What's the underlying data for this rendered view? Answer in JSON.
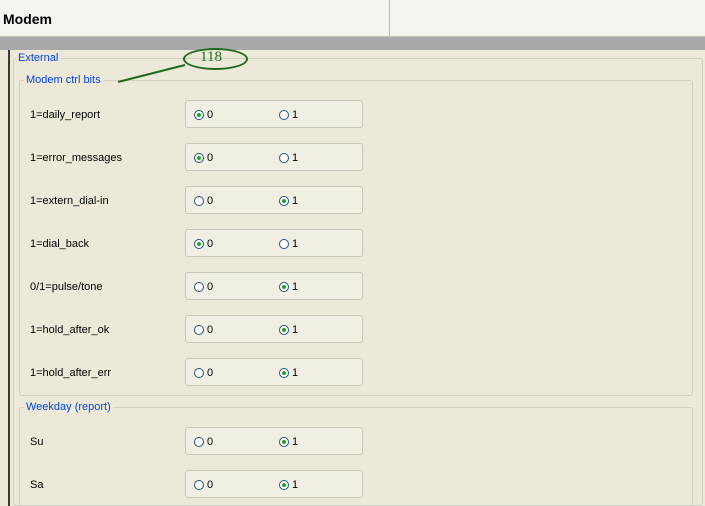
{
  "header": {
    "title": "Modem"
  },
  "callout": {
    "number": "118"
  },
  "external": {
    "legend": "External"
  },
  "modem_ctrl": {
    "legend": "Modem ctrl bits",
    "rows": [
      {
        "label": "1=daily_report",
        "opt0": "0",
        "opt1": "1",
        "selected": "0"
      },
      {
        "label": "1=error_messages",
        "opt0": "0",
        "opt1": "1",
        "selected": "0"
      },
      {
        "label": "1=extern_dial-in",
        "opt0": "0",
        "opt1": "1",
        "selected": "1"
      },
      {
        "label": "1=dial_back",
        "opt0": "0",
        "opt1": "1",
        "selected": "0"
      },
      {
        "label": "0/1=pulse/tone",
        "opt0": "0",
        "opt1": "1",
        "selected": "1"
      },
      {
        "label": "1=hold_after_ok",
        "opt0": "0",
        "opt1": "1",
        "selected": "1"
      },
      {
        "label": "1=hold_after_err",
        "opt0": "0",
        "opt1": "1",
        "selected": "1"
      }
    ]
  },
  "weekday": {
    "legend": "Weekday (report)",
    "rows": [
      {
        "label": "Su",
        "opt0": "0",
        "opt1": "1",
        "selected": "1"
      },
      {
        "label": "Sa",
        "opt0": "0",
        "opt1": "1",
        "selected": "1"
      }
    ]
  },
  "colors": {
    "legend_text": "#0046d5",
    "radio_dot": "#21a121",
    "callout": "#1d6b1d",
    "background": "#ece9d8"
  }
}
